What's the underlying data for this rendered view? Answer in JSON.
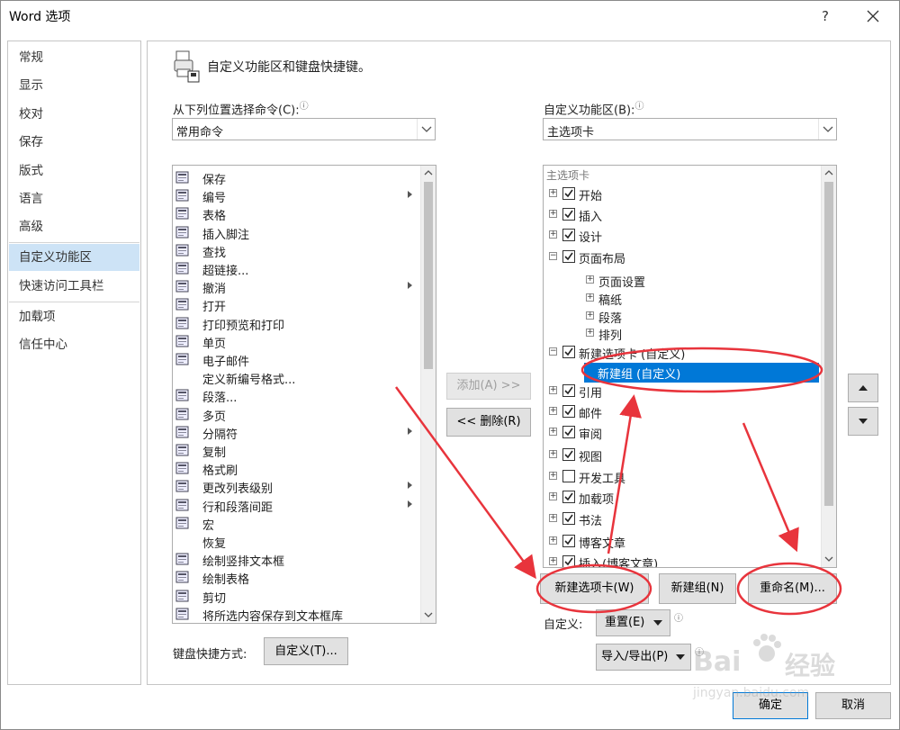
{
  "window": {
    "title": "Word 选项",
    "help": "?"
  },
  "nav": {
    "items": [
      "常规",
      "显示",
      "校对",
      "保存",
      "版式",
      "语言",
      "高级",
      "自定义功能区",
      "快速访问工具栏",
      "加载项",
      "信任中心"
    ],
    "selected": "自定义功能区"
  },
  "header": {
    "title": "自定义功能区和键盘快捷键。"
  },
  "commands": {
    "label": "从下列位置选择命令(C):",
    "source": "常用命令",
    "items": [
      {
        "label": "保存",
        "icon": "save-icon"
      },
      {
        "label": "编号",
        "icon": "numbering-icon"
      },
      {
        "label": "表格",
        "icon": "table-icon"
      },
      {
        "label": "插入脚注",
        "icon": "footnote-icon"
      },
      {
        "label": "查找",
        "icon": "binoculars-icon"
      },
      {
        "label": "超链接...",
        "icon": "hyperlink-icon"
      },
      {
        "label": "撤消",
        "icon": "undo-icon"
      },
      {
        "label": "打开",
        "icon": "folder-icon"
      },
      {
        "label": "打印预览和打印",
        "icon": "print-preview-icon"
      },
      {
        "label": "单页",
        "icon": "single-page-icon"
      },
      {
        "label": "电子邮件",
        "icon": "email-icon"
      },
      {
        "label": "定义新编号格式...",
        "icon": ""
      },
      {
        "label": "段落...",
        "icon": "paragraph-icon"
      },
      {
        "label": "多页",
        "icon": "multi-page-icon"
      },
      {
        "label": "分隔符",
        "icon": "break-icon"
      },
      {
        "label": "复制",
        "icon": "copy-icon"
      },
      {
        "label": "格式刷",
        "icon": "format-painter-icon"
      },
      {
        "label": "更改列表级别",
        "icon": "list-level-icon"
      },
      {
        "label": "行和段落间距",
        "icon": "line-spacing-icon"
      },
      {
        "label": "宏",
        "icon": "macro-icon"
      },
      {
        "label": "恢复",
        "icon": ""
      },
      {
        "label": "绘制竖排文本框",
        "icon": "vertical-textbox-icon"
      },
      {
        "label": "绘制表格",
        "icon": "draw-table-icon"
      },
      {
        "label": "剪切",
        "icon": "scissors-icon"
      },
      {
        "label": "将所选内容保存到文本框库",
        "icon": "textbox-gallery-icon"
      }
    ]
  },
  "buttons": {
    "add": "添加(A) >>",
    "remove": "<< 删除(R)",
    "new_tab": "新建选项卡(W)",
    "new_group": "新建组(N)",
    "rename": "重命名(M)...",
    "reset": "重置(E)",
    "import_export": "导入/导出(P)",
    "keyboard_customize": "自定义(T)...",
    "ok": "确定",
    "cancel": "取消"
  },
  "ribbon": {
    "label": "自定义功能区(B):",
    "source": "主选项卡",
    "header": "主选项卡",
    "items": [
      {
        "label": "开始",
        "level": 0,
        "expander": "+",
        "checked": true
      },
      {
        "label": "插入",
        "level": 0,
        "expander": "+",
        "checked": true
      },
      {
        "label": "设计",
        "level": 0,
        "expander": "+",
        "checked": true
      },
      {
        "label": "页面布局",
        "level": 0,
        "expander": "-",
        "checked": true
      },
      {
        "label": "页面设置",
        "level": 1,
        "expander": "+"
      },
      {
        "label": "稿纸",
        "level": 1,
        "expander": "+"
      },
      {
        "label": "段落",
        "level": 1,
        "expander": "+"
      },
      {
        "label": "排列",
        "level": 1,
        "expander": "+"
      },
      {
        "label": "新建选项卡 (自定义)",
        "level": 0,
        "expander": "-",
        "checked": true
      },
      {
        "label": "新建组 (自定义)",
        "level": 1,
        "selected": true
      },
      {
        "label": "引用",
        "level": 0,
        "expander": "+",
        "checked": true
      },
      {
        "label": "邮件",
        "level": 0,
        "expander": "+",
        "checked": true
      },
      {
        "label": "审阅",
        "level": 0,
        "expander": "+",
        "checked": true
      },
      {
        "label": "视图",
        "level": 0,
        "expander": "+",
        "checked": true
      },
      {
        "label": "开发工具",
        "level": 0,
        "expander": "+",
        "checked": false
      },
      {
        "label": "加载项",
        "level": 0,
        "expander": "+",
        "checked": true
      },
      {
        "label": "书法",
        "level": 0,
        "expander": "+",
        "checked": true
      },
      {
        "label": "博客文章",
        "level": 0,
        "expander": "+",
        "checked": true
      },
      {
        "label": "插入(博客文章)",
        "level": 0,
        "expander": "+",
        "checked": true
      }
    ]
  },
  "customize": {
    "label": "自定义:"
  },
  "keyboard": {
    "label": "键盘快捷方式:"
  },
  "watermark": {
    "brand": "Bai",
    "brand_suffix": "经验",
    "url": "jingyan.baidu.com"
  },
  "colors": {
    "selection": "#0078d7",
    "nav_selected": "#cde3f6",
    "annotation": "#e8343c"
  }
}
